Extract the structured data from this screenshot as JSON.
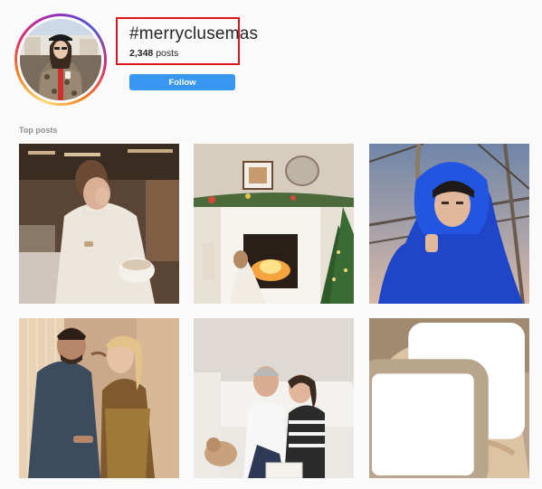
{
  "hashtag": {
    "title": "#merryclusemas",
    "post_count": "2,348",
    "post_count_suffix": " posts",
    "follow_label": "Follow"
  },
  "top_posts": {
    "label": "Top posts",
    "posts": [
      {
        "alt": "Woman in white sweater with coffee cup in cafe"
      },
      {
        "alt": "Woman by fireplace with Christmas tree and garland"
      },
      {
        "alt": "Woman in blue puffer jacket with fur hood on bridge"
      },
      {
        "alt": "Couple kissing by holiday lights"
      },
      {
        "alt": "Couple on white sofa with dog"
      },
      {
        "alt": "Woman in beige teddy coat"
      }
    ],
    "multi_icon": "carousel-icon"
  },
  "colors": {
    "accent": "#3897f0",
    "highlight_box": "#e0151b",
    "background": "#fafafa"
  }
}
